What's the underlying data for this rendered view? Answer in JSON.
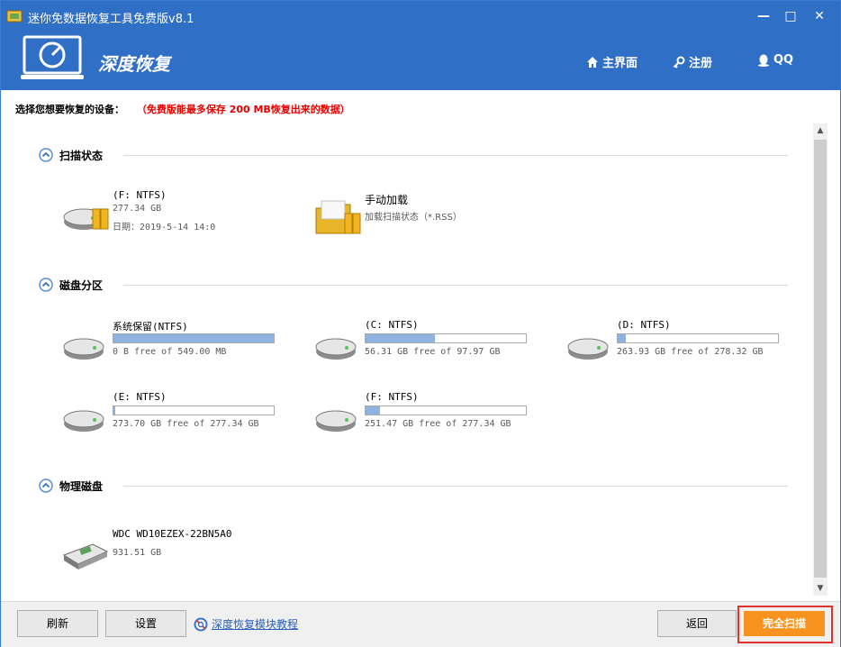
{
  "window": {
    "title": "迷你免数据恢复工具免费版v8.1",
    "controls": [
      "minimize",
      "maximize",
      "close"
    ]
  },
  "header": {
    "title": "深度恢复",
    "nav": [
      {
        "label": "主界面",
        "icon": "home-icon"
      },
      {
        "label": "注册",
        "icon": "key-icon"
      },
      {
        "label": "QQ",
        "icon": "qq-icon"
      }
    ]
  },
  "prompt": {
    "text": "选择您想要恢复的设备：",
    "note": "（免费版能最多保存 200 MB恢复出来的数据）"
  },
  "sections": {
    "scan_status": {
      "title": "扫描状态",
      "items": [
        {
          "name": "(F: NTFS)",
          "size": "277.34 GB",
          "date": "日期：2019-5-14 14:0"
        },
        {
          "name": "手动加载",
          "desc": "加载扫描状态（*.RSS）"
        }
      ]
    },
    "partitions": {
      "title": "磁盘分区",
      "items": [
        {
          "name": "系统保留(NTFS)",
          "free": "0 B free of 549.00 MB",
          "used_fraction": 1.0
        },
        {
          "name": "(C: NTFS)",
          "free": "56.31 GB free of 97.97 GB",
          "used_fraction": 0.43
        },
        {
          "name": "(D: NTFS)",
          "free": "263.93 GB free of 278.32 GB",
          "used_fraction": 0.05
        },
        {
          "name": "(E: NTFS)",
          "free": "273.70 GB free of 277.34 GB",
          "used_fraction": 0.013
        },
        {
          "name": "(F: NTFS)",
          "free": "251.47 GB free of 277.34 GB",
          "used_fraction": 0.09
        }
      ]
    },
    "physical": {
      "title": "物理磁盘",
      "items": [
        {
          "name": "WDC WD10EZEX-22BN5A0",
          "size": "931.51 GB"
        }
      ]
    }
  },
  "footer": {
    "refresh": "刷新",
    "settings": "设置",
    "help_link": "深度恢复模块教程",
    "back": "返回",
    "full_scan": "完全扫描"
  },
  "colors": {
    "header_blue": "#2f6fc6",
    "accent_orange": "#f7931e",
    "note_red": "#e80000",
    "bar_fill": "#8fb3e0"
  }
}
